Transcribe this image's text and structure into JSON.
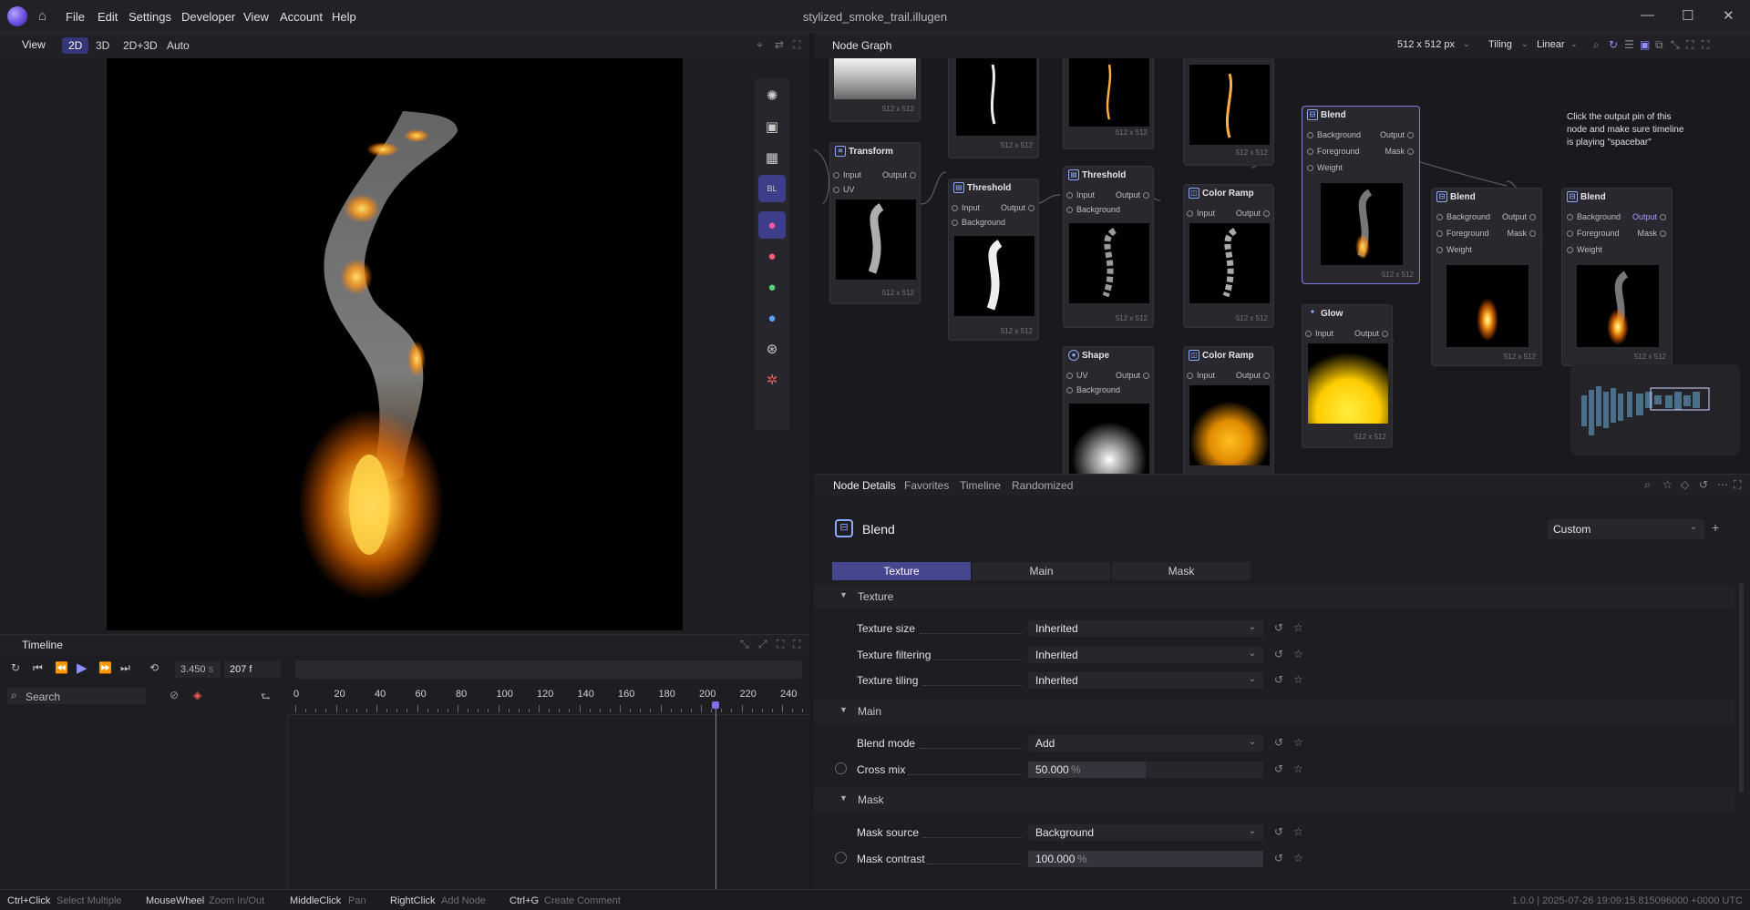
{
  "app": {
    "window_title": "stylized_smoke_trail.illugen"
  },
  "menu": [
    "File",
    "Edit",
    "Settings",
    "Developer",
    "View",
    "Account",
    "Help"
  ],
  "view_panel": {
    "title": "View",
    "modes": [
      "2D",
      "3D",
      "2D+3D",
      "Auto"
    ],
    "active_mode": "2D"
  },
  "timeline": {
    "title": "Timeline",
    "time_value": "3.450",
    "time_unit": "s",
    "frame": "207 f",
    "search_placeholder": "Search",
    "ruler": [
      "0",
      "20",
      "40",
      "60",
      "80",
      "100",
      "120",
      "140",
      "160",
      "180",
      "200",
      "220",
      "240"
    ],
    "playhead_frame": 207
  },
  "node_graph": {
    "title": "Node Graph",
    "resolution": "512 x 512 px",
    "tiling": "Tiling",
    "filtering": "Linear",
    "hint": "Click the output pin of this node and make sure timeline is  playing \"spacebar\"",
    "size_label": "512 x 512",
    "nodes": {
      "transform": {
        "title": "Transform",
        "pins": [
          "Input",
          "Output",
          "UV"
        ]
      },
      "threshold1": {
        "title": "Threshold",
        "pins": [
          "Input",
          "Output",
          "Background"
        ]
      },
      "threshold2": {
        "title": "Threshold",
        "pins": [
          "Input",
          "Output",
          "Background"
        ]
      },
      "colorramp1": {
        "title": "Color Ramp",
        "pins": [
          "Input",
          "Output"
        ]
      },
      "blend1": {
        "title": "Blend",
        "pins": [
          "Background",
          "Output",
          "Foreground",
          "Mask",
          "Weight"
        ]
      },
      "blend2": {
        "title": "Blend",
        "pins": [
          "Background",
          "Output",
          "Foreground",
          "Mask",
          "Weight"
        ]
      },
      "blend3": {
        "title": "Blend",
        "pins": [
          "Background",
          "Output",
          "Foreground",
          "Mask",
          "Weight"
        ]
      },
      "shape": {
        "title": "Shape",
        "pins": [
          "UV",
          "Output",
          "Background"
        ]
      },
      "colorramp2": {
        "title": "Color Ramp",
        "pins": [
          "Input",
          "Output"
        ]
      },
      "glow": {
        "title": "Glow",
        "pins": [
          "Input",
          "Output"
        ]
      }
    }
  },
  "node_details": {
    "tabs": [
      "Node Details",
      "Favorites",
      "Timeline",
      "Randomized"
    ],
    "node_name": "Blend",
    "preset": "Custom",
    "param_tabs": [
      "Texture",
      "Main",
      "Mask"
    ],
    "sections": {
      "texture": {
        "title": "Texture",
        "rows": [
          {
            "label": "Texture size",
            "value": "Inherited"
          },
          {
            "label": "Texture filtering",
            "value": "Inherited"
          },
          {
            "label": "Texture tiling",
            "value": "Inherited"
          }
        ]
      },
      "main": {
        "title": "Main",
        "rows": [
          {
            "label": "Blend mode",
            "value": "Add"
          },
          {
            "label": "Cross mix",
            "value": "50.000",
            "unit": "%",
            "fraction": 0.5
          }
        ]
      },
      "mask": {
        "title": "Mask",
        "rows": [
          {
            "label": "Mask source",
            "value": "Background"
          },
          {
            "label": "Mask contrast",
            "value": "100.000",
            "unit": "%",
            "fraction": 1.0
          }
        ]
      }
    }
  },
  "status_bar": {
    "hints": [
      {
        "key": "Ctrl+Click",
        "desc": "Select Multiple"
      },
      {
        "key": "MouseWheel",
        "desc": "Zoom In/Out"
      },
      {
        "key": "MiddleClick",
        "desc": "Pan"
      },
      {
        "key": "RightClick",
        "desc": "Add Node"
      },
      {
        "key": "Ctrl+G",
        "desc": "Create Comment"
      }
    ],
    "version": "1.0.0  |  2025-07-26 19:09:15.815096000 +0000 UTC"
  },
  "colors": {
    "accent": "#46468f",
    "accent_light": "#7f7fe0",
    "flame": "#ff9a1a"
  }
}
